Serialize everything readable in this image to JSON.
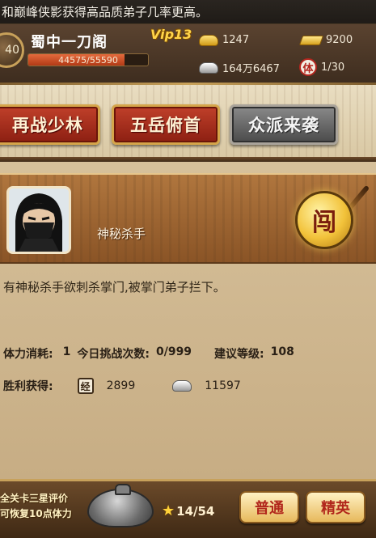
{
  "marquee": {
    "text": "和巅峰侠影获得高品质弟子几率更高。"
  },
  "header": {
    "level": "40",
    "sect_name": "蜀中一刀阁",
    "xp": {
      "text": "44575/55590",
      "fraction": 0.802
    },
    "vip": "Vip13",
    "resources": {
      "gold_ingot": "1247",
      "gold_bar": "9200",
      "silver": "164万6467",
      "stamina": "1/30",
      "stamina_badge": "体"
    },
    "icons": {
      "gold_ingot": "gold-ingot-icon",
      "gold_bar": "gold-bar-icon",
      "silver": "silver-ingot-icon",
      "stamina": "stamina-badge-icon"
    }
  },
  "actions": {
    "buttons": [
      "再战少林",
      "五岳俯首",
      "众派来袭"
    ]
  },
  "event": {
    "npc_name": "神秘杀手",
    "seal_char": "闯",
    "description": "有神秘杀手欲刺杀掌门,被掌门弟子拦下。",
    "stats": {
      "stamina_label": "体力消耗:",
      "stamina_value": "1",
      "challenges_label": "今日挑战次数:",
      "challenges_value": "0/999",
      "level_label": "建议等级:",
      "level_value": "108"
    },
    "reward": {
      "label": "胜利获得:",
      "exp_stamp": "经",
      "exp_value": "2899",
      "silver_value": "11597"
    }
  },
  "bottom": {
    "promo_line1": "全关卡三星评价",
    "promo_line2": "可恢复10点体力",
    "stars": "14/54",
    "normal_button": "普通",
    "elite_button": "精英"
  },
  "colors": {
    "accent_red": "#8c1f12",
    "gold": "#d5a54a",
    "parchment": "#d6c09a"
  }
}
